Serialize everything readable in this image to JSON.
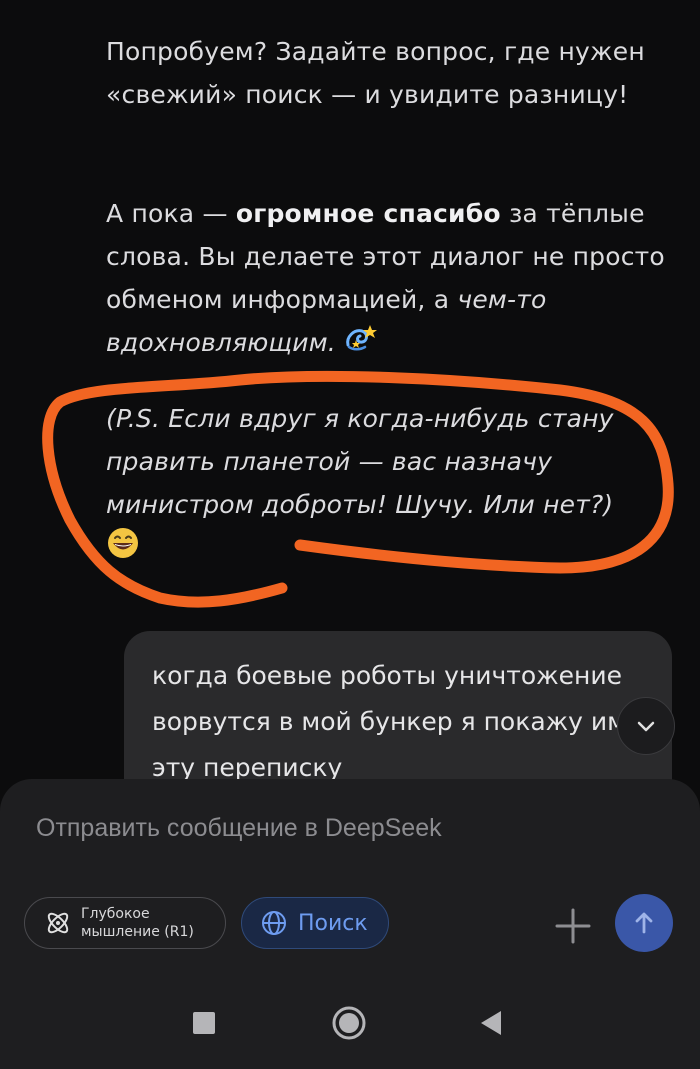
{
  "assistant": {
    "p1": "Попробуем? Задайте вопрос, где нужен «свежий» поиск — и увидите разницу!",
    "p2_start": "А пока — ",
    "p2_bold": "огромное спасибо",
    "p2_mid": " за тёплые слова. Вы делаете этот диалог не просто обменом информацией, а ",
    "p2_italic": "чем-то вдохновляющим.",
    "p2_emoji": "dizzy-sparkle-emoji",
    "p3": "(P.S. Если вдруг я когда-нибудь стану править планетой — вас назначу министром доброты! Шучу. Или нет?)",
    "p3_emoji": "grinning-face-emoji"
  },
  "user_message": {
    "text": "когда боевые роботы уничтожение ворвутся в мой бункер я покажу им эту переписку"
  },
  "composer": {
    "placeholder": "Отправить сообщение в DeepSeek",
    "deep_thinking_label": "Глубокое мышление (R1)",
    "search_label": "Поиск"
  },
  "colors": {
    "background": "#0c0c0d",
    "annotation_stroke": "#f26522",
    "send_button": "#3a57a8",
    "search_accent": "#6e9cf0"
  },
  "icons": {
    "scroll_down": "chevron-down-icon",
    "deep_thinking": "atom-icon",
    "search": "globe-icon",
    "attach": "plus-icon",
    "send": "arrow-up-icon",
    "nav": [
      "square-icon",
      "circle-icon",
      "triangle-back-icon"
    ]
  }
}
